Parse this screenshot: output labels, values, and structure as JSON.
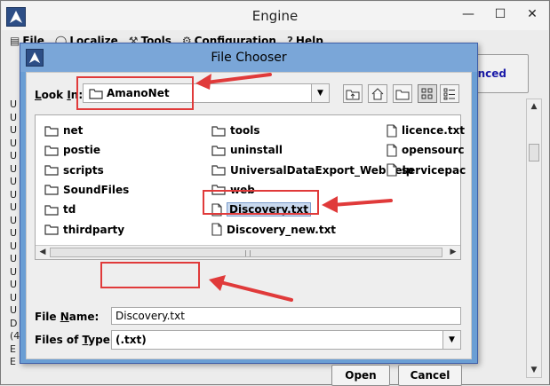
{
  "outer": {
    "title": "Engine",
    "menu": [
      {
        "label": "File",
        "icon": "file-menu-icon"
      },
      {
        "label": "Localize",
        "icon": "globe-icon"
      },
      {
        "label": "Tools",
        "icon": "tools-icon"
      },
      {
        "label": "Configuration",
        "icon": "gear-icon"
      },
      {
        "label": "Help",
        "icon": "help-icon"
      }
    ],
    "advanced_label": "anced",
    "log_prefix": [
      "U",
      "U",
      "U",
      "U",
      "U",
      "U",
      "U",
      "U",
      "U",
      "U",
      "U",
      "U",
      "U",
      "U",
      "U",
      "U",
      "U",
      "D",
      "(4",
      "E",
      "E"
    ]
  },
  "dialog": {
    "title": "File Chooser",
    "look_in_label": "Look In:",
    "look_in_value": "AmanoNet",
    "files": [
      {
        "name": "net",
        "type": "folder"
      },
      {
        "name": "postie",
        "type": "folder"
      },
      {
        "name": "scripts",
        "type": "folder"
      },
      {
        "name": "SoundFiles",
        "type": "folder"
      },
      {
        "name": "td",
        "type": "folder"
      },
      {
        "name": "thirdparty",
        "type": "folder"
      },
      {
        "name": "tools",
        "type": "folder"
      },
      {
        "name": "uninstall",
        "type": "folder"
      },
      {
        "name": "UniversalDataExport_WebHelp",
        "type": "folder"
      },
      {
        "name": "web",
        "type": "folder"
      },
      {
        "name": "Discovery.txt",
        "type": "file",
        "selected": true
      },
      {
        "name": "Discovery_new.txt",
        "type": "file"
      },
      {
        "name": "licence.txt",
        "type": "file"
      },
      {
        "name": "opensourc",
        "type": "file"
      },
      {
        "name": "servicepac",
        "type": "file"
      }
    ],
    "file_name_label": "File Name:",
    "file_name_value": "Discovery.txt",
    "files_of_type_label": "Files of Type:",
    "files_of_type_value": "(.txt)",
    "open_label": "Open",
    "cancel_label": "Cancel"
  },
  "colors": {
    "annotation_red": "#e03a3a",
    "dialog_border": "#6a9ed4",
    "advanced_text": "#1a1aa8"
  }
}
